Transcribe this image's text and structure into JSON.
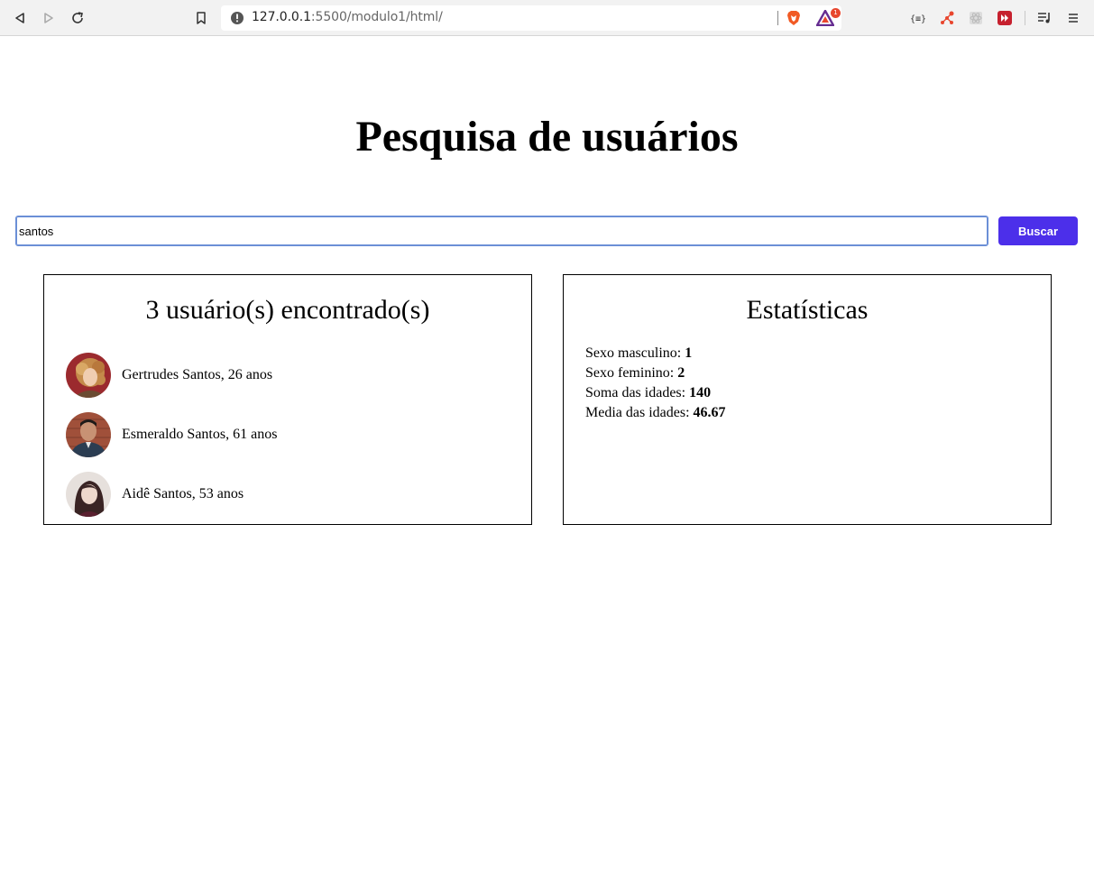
{
  "browser": {
    "url_host": "127.0.0.1",
    "url_rest": ":5500/modulo1/html/",
    "rewards_badge": "1"
  },
  "page": {
    "title": "Pesquisa de usuários"
  },
  "search": {
    "value": "santos",
    "button_label": "Buscar",
    "button_color": "#4c2fea"
  },
  "results": {
    "heading": "3 usuário(s) encontrado(s)",
    "users": [
      {
        "text": "Gertrudes Santos, 26 anos",
        "avatar": "woman-curly-hair-avatar"
      },
      {
        "text": "Esmeraldo Santos, 61 anos",
        "avatar": "man-brick-wall-avatar"
      },
      {
        "text": "Aidê Santos, 53 anos",
        "avatar": "woman-dark-hair-avatar"
      }
    ]
  },
  "stats": {
    "heading": "Estatísticas",
    "rows": [
      {
        "label": "Sexo masculino: ",
        "value": "1"
      },
      {
        "label": "Sexo feminino: ",
        "value": "2"
      },
      {
        "label": "Soma das idades: ",
        "value": "140"
      },
      {
        "label": "Media das idades: ",
        "value": "46.67"
      }
    ]
  }
}
